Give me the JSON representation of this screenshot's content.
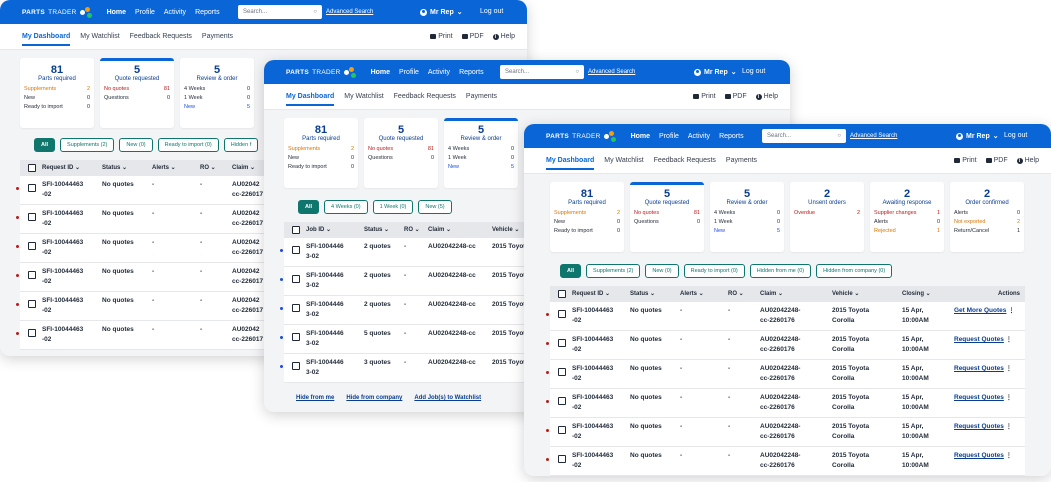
{
  "app": {
    "logo": {
      "brand": "PARTS",
      "suffix": "TRADER"
    },
    "nav": [
      "Home",
      "Profile",
      "Activity",
      "Reports"
    ],
    "search_placeholder": "Search...",
    "advanced_search": "Advanced Search",
    "user": "Mr Rep",
    "logout": "Log out",
    "subnav": [
      "My Dashboard",
      "My Watchlist",
      "Feedback Requests",
      "Payments"
    ],
    "tools": {
      "print": "Print",
      "pdf": "PDF",
      "help": "Help"
    }
  },
  "cards": [
    {
      "num": "81",
      "label": "Parts required",
      "rows": [
        [
          "Supplements",
          "2"
        ],
        [
          "New",
          "0"
        ],
        [
          "Ready to import",
          "0"
        ]
      ]
    },
    {
      "num": "5",
      "label": "Quote requested",
      "rows": [
        [
          "No quotes",
          "81"
        ],
        [
          "Questions",
          "0"
        ]
      ]
    },
    {
      "num": "5",
      "label": "Review & order",
      "rows": [
        [
          "4 Weeks",
          "0"
        ],
        [
          "1 Week",
          "0"
        ],
        [
          "New",
          "5"
        ]
      ]
    },
    {
      "num": "2",
      "label": "Unsent orders",
      "rows": [
        [
          "Overdue",
          "2"
        ]
      ]
    },
    {
      "num": "2",
      "label": "Awaiting response",
      "rows": [
        [
          "Supplier changes",
          "1"
        ],
        [
          "Alerts",
          "0"
        ],
        [
          "Rejected",
          "1"
        ]
      ]
    },
    {
      "num": "2",
      "label": "Order confirmed",
      "rows": [
        [
          "Alerts",
          "0"
        ],
        [
          "Not exported",
          "2"
        ],
        [
          "Return/Cancel",
          "1"
        ]
      ]
    }
  ],
  "filters_main": [
    "All",
    "Supplements (2)",
    "New (0)",
    "Ready to import (0)",
    "Hidden from me (0)",
    "Hidden from company (0)"
  ],
  "filters_w1_partial": "Hidden f",
  "filters_review": [
    "All",
    "4 Weeks (0)",
    "1 Week (0)",
    "New (5)"
  ],
  "table_main": {
    "headers": [
      "Request ID",
      "Status",
      "Alerts",
      "RO",
      "Claim",
      "Vehicle",
      "Closing",
      "Actions"
    ],
    "rows": [
      {
        "id": [
          "SFI-10044463",
          "-02"
        ],
        "status": "No quotes",
        "alerts": "-",
        "ro": "-",
        "claim": [
          "AU02042248-",
          "cc-2260176"
        ],
        "vehicle": [
          "2015 Toyota",
          "Corolla"
        ],
        "closing": [
          "15 Apr,",
          "10:00AM"
        ],
        "action": "Get More Quotes"
      },
      {
        "id": [
          "SFI-10044463",
          "-02"
        ],
        "status": "No quotes",
        "alerts": "-",
        "ro": "-",
        "claim": [
          "AU02042248-",
          "cc-2260176"
        ],
        "vehicle": [
          "2015 Toyota",
          "Corolla"
        ],
        "closing": [
          "15 Apr,",
          "10:00AM"
        ],
        "action": "Request Quotes"
      },
      {
        "id": [
          "SFI-10044463",
          "-02"
        ],
        "status": "No quotes",
        "alerts": "-",
        "ro": "-",
        "claim": [
          "AU02042248-",
          "cc-2260176"
        ],
        "vehicle": [
          "2015 Toyota",
          "Corolla"
        ],
        "closing": [
          "15 Apr,",
          "10:00AM"
        ],
        "action": "Request Quotes"
      },
      {
        "id": [
          "SFI-10044463",
          "-02"
        ],
        "status": "No quotes",
        "alerts": "-",
        "ro": "-",
        "claim": [
          "AU02042248-",
          "cc-2260176"
        ],
        "vehicle": [
          "2015 Toyota",
          "Corolla"
        ],
        "closing": [
          "15 Apr,",
          "10:00AM"
        ],
        "action": "Request Quotes"
      },
      {
        "id": [
          "SFI-10044463",
          "-02"
        ],
        "status": "No quotes",
        "alerts": "-",
        "ro": "-",
        "claim": [
          "AU02042248-",
          "cc-2260176"
        ],
        "vehicle": [
          "2015 Toyota",
          "Corolla"
        ],
        "closing": [
          "15 Apr,",
          "10:00AM"
        ],
        "action": "Request Quotes"
      },
      {
        "id": [
          "SFI-10044463",
          "-02"
        ],
        "status": "No quotes",
        "alerts": "-",
        "ro": "-",
        "claim": [
          "AU02042248-",
          "cc-2260176"
        ],
        "vehicle": [
          "2015 Toyota",
          "Corolla"
        ],
        "closing": [
          "15 Apr,",
          "10:00AM"
        ],
        "action": "Request Quotes"
      }
    ],
    "w1_claim": [
      "AU02042",
      "cc-226017"
    ]
  },
  "table_review": {
    "headers": [
      "Job ID",
      "Status",
      "RO",
      "Claim",
      "Vehicle"
    ],
    "rows": [
      {
        "id": [
          "SFI-1004446",
          "3-02"
        ],
        "status": "2 quotes",
        "ro": "-",
        "claim": "AU02042248-cc",
        "vehicle": "2015 Toyot"
      },
      {
        "id": [
          "SFI-1004446",
          "3-02"
        ],
        "status": "2 quotes",
        "ro": "-",
        "claim": "AU02042248-cc",
        "vehicle": "2015 Toyot"
      },
      {
        "id": [
          "SFI-1004446",
          "3-02"
        ],
        "status": "2 quotes",
        "ro": "-",
        "claim": "AU02042248-cc",
        "vehicle": "2015 Toyot"
      },
      {
        "id": [
          "SFI-1004446",
          "3-02"
        ],
        "status": "5 quotes",
        "ro": "-",
        "claim": "AU02042248-cc",
        "vehicle": "2015 Toyot"
      },
      {
        "id": [
          "SFI-1004446",
          "3-02"
        ],
        "status": "3 quotes",
        "ro": "-",
        "claim": "AU02042248-cc",
        "vehicle": "2015 Toyot"
      }
    ],
    "footer": [
      "Hide from me",
      "Hide from company",
      "Add Job(s) to Watchlist"
    ]
  },
  "colors": {
    "brand_blue": "#0a66d6",
    "teal": "#0f766e",
    "red": "#b91c1c",
    "orange": "#d97706"
  }
}
